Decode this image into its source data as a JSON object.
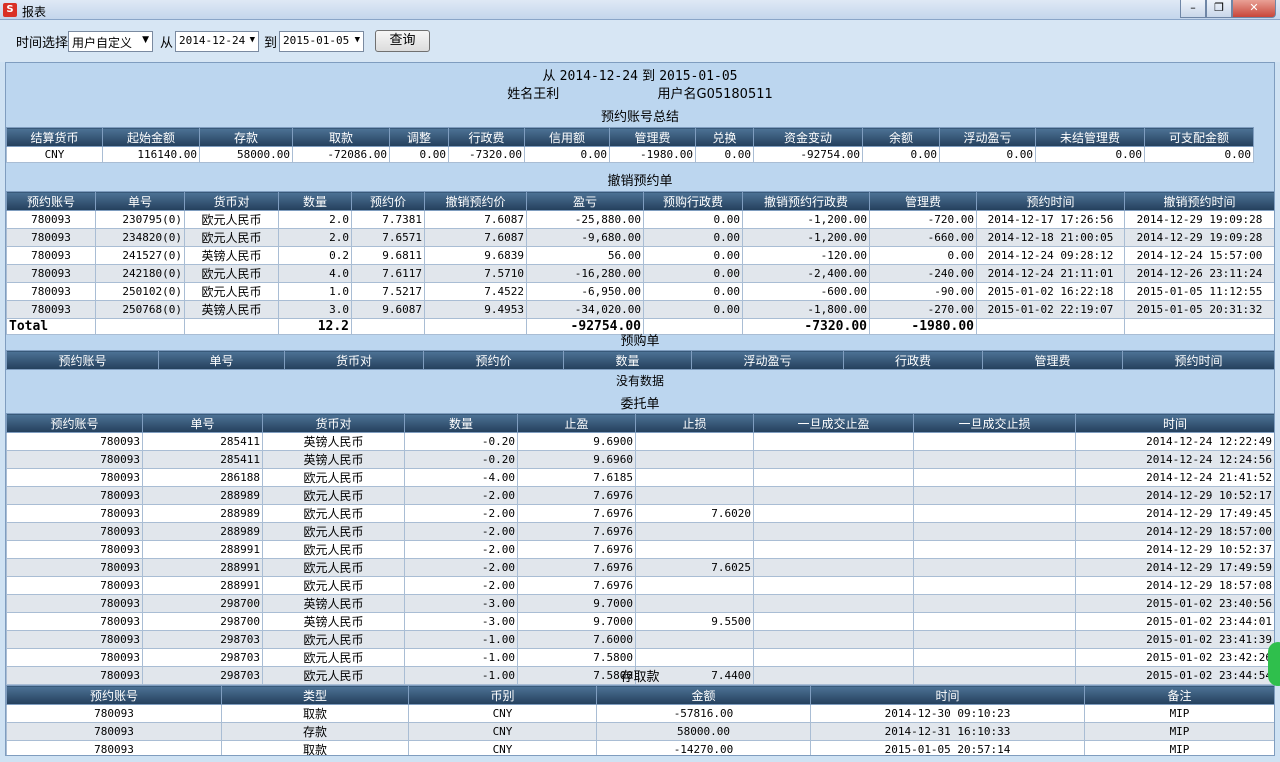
{
  "window": {
    "title": "报表",
    "icon": "S",
    "controls": [
      "minimize-icon",
      "restore-icon",
      "close-icon"
    ]
  },
  "toolbar": {
    "time_label": "时间选择",
    "time_option": "用户自定义",
    "from_label": "从",
    "from_date": "2014-12-24",
    "to_label": "到",
    "to_date": "2015-01-05",
    "query_label": "查询"
  },
  "report": {
    "range": {
      "from": "从",
      "from_date": "2014-12-24",
      "to": "到",
      "to_date": "2015-01-05"
    },
    "name": "姓名王利",
    "user": "用户名G05180511",
    "summary": {
      "title": "预约账号总结",
      "headers": [
        "结算货币",
        "起始金额",
        "存款",
        "取款",
        "调整",
        "行政费",
        "信用额",
        "管理费",
        "兑换",
        "资金变动",
        "余额",
        "浮动盈亏",
        "未结管理费",
        "可支配金额"
      ],
      "row": [
        "CNY",
        "116140.00",
        "58000.00",
        "-72086.00",
        "0.00",
        "-7320.00",
        "0.00",
        "-1980.00",
        "0.00",
        "-92754.00",
        "0.00",
        "0.00",
        "0.00",
        "0.00"
      ]
    },
    "cancel": {
      "title": "撤销预约单",
      "headers": [
        "预约账号",
        "单号",
        "货币对",
        "数量",
        "预约价",
        "撤销预约价",
        "盈亏",
        "预购行政费",
        "撤销预约行政费",
        "管理费",
        "预约时间",
        "撤销预约时间"
      ],
      "rows": [
        [
          "780093",
          "230795(0)",
          "欧元人民币",
          "2.0",
          "7.7381",
          "7.6087",
          "-25,880.00",
          "0.00",
          "-1,200.00",
          "-720.00",
          "2014-12-17 17:26:56",
          "2014-12-29 19:09:28"
        ],
        [
          "780093",
          "234820(0)",
          "欧元人民币",
          "2.0",
          "7.6571",
          "7.6087",
          "-9,680.00",
          "0.00",
          "-1,200.00",
          "-660.00",
          "2014-12-18 21:00:05",
          "2014-12-29 19:09:28"
        ],
        [
          "780093",
          "241527(0)",
          "英镑人民币",
          "0.2",
          "9.6811",
          "9.6839",
          "56.00",
          "0.00",
          "-120.00",
          "0.00",
          "2014-12-24 09:28:12",
          "2014-12-24 15:57:00"
        ],
        [
          "780093",
          "242180(0)",
          "欧元人民币",
          "4.0",
          "7.6117",
          "7.5710",
          "-16,280.00",
          "0.00",
          "-2,400.00",
          "-240.00",
          "2014-12-24 21:11:01",
          "2014-12-26 23:11:24"
        ],
        [
          "780093",
          "250102(0)",
          "欧元人民币",
          "1.0",
          "7.5217",
          "7.4522",
          "-6,950.00",
          "0.00",
          "-600.00",
          "-90.00",
          "2015-01-02 16:22:18",
          "2015-01-05 11:12:55"
        ],
        [
          "780093",
          "250768(0)",
          "英镑人民币",
          "3.0",
          "9.6087",
          "9.4953",
          "-34,020.00",
          "0.00",
          "-1,800.00",
          "-270.00",
          "2015-01-02 22:19:07",
          "2015-01-05 20:31:32"
        ]
      ],
      "total": [
        "Total",
        "",
        "",
        "12.2",
        "",
        "",
        "-92754.00",
        "",
        "-7320.00",
        "-1980.00",
        "",
        ""
      ]
    },
    "presale": {
      "title": "预购单",
      "headers": [
        "预约账号",
        "单号",
        "货币对",
        "预约价",
        "数量",
        "浮动盈亏",
        "行政费",
        "管理费",
        "预约时间"
      ],
      "empty": "没有数据"
    },
    "orders": {
      "title": "委托单",
      "headers": [
        "预约账号",
        "单号",
        "货币对",
        "数量",
        "止盈",
        "止损",
        "一旦成交止盈",
        "一旦成交止损",
        "时间"
      ],
      "rows": [
        [
          "780093",
          "285411",
          "英镑人民币",
          "-0.20",
          "9.6900",
          "",
          "",
          "",
          "2014-12-24 12:22:49"
        ],
        [
          "780093",
          "285411",
          "英镑人民币",
          "-0.20",
          "9.6960",
          "",
          "",
          "",
          "2014-12-24 12:24:56"
        ],
        [
          "780093",
          "286188",
          "欧元人民币",
          "-4.00",
          "7.6185",
          "",
          "",
          "",
          "2014-12-24 21:41:52"
        ],
        [
          "780093",
          "288989",
          "欧元人民币",
          "-2.00",
          "7.6976",
          "",
          "",
          "",
          "2014-12-29 10:52:17"
        ],
        [
          "780093",
          "288989",
          "欧元人民币",
          "-2.00",
          "7.6976",
          "7.6020",
          "",
          "",
          "2014-12-29 17:49:45"
        ],
        [
          "780093",
          "288989",
          "欧元人民币",
          "-2.00",
          "7.6976",
          "",
          "",
          "",
          "2014-12-29 18:57:00"
        ],
        [
          "780093",
          "288991",
          "欧元人民币",
          "-2.00",
          "7.6976",
          "",
          "",
          "",
          "2014-12-29 10:52:37"
        ],
        [
          "780093",
          "288991",
          "欧元人民币",
          "-2.00",
          "7.6976",
          "7.6025",
          "",
          "",
          "2014-12-29 17:49:59"
        ],
        [
          "780093",
          "288991",
          "欧元人民币",
          "-2.00",
          "7.6976",
          "",
          "",
          "",
          "2014-12-29 18:57:08"
        ],
        [
          "780093",
          "298700",
          "英镑人民币",
          "-3.00",
          "9.7000",
          "",
          "",
          "",
          "2015-01-02 23:40:56"
        ],
        [
          "780093",
          "298700",
          "英镑人民币",
          "-3.00",
          "9.7000",
          "9.5500",
          "",
          "",
          "2015-01-02 23:44:01"
        ],
        [
          "780093",
          "298703",
          "欧元人民币",
          "-1.00",
          "7.6000",
          "",
          "",
          "",
          "2015-01-02 23:41:39"
        ],
        [
          "780093",
          "298703",
          "欧元人民币",
          "-1.00",
          "7.5800",
          "",
          "",
          "",
          "2015-01-02 23:42:26"
        ],
        [
          "780093",
          "298703",
          "欧元人民币",
          "-1.00",
          "7.5800",
          "7.4400",
          "",
          "",
          "2015-01-02 23:44:54"
        ]
      ]
    },
    "deposits": {
      "title": "存取款",
      "headers": [
        "预约账号",
        "类型",
        "币别",
        "金额",
        "时间",
        "备注"
      ],
      "rows": [
        [
          "780093",
          "取款",
          "CNY",
          "-57816.00",
          "2014-12-30 09:10:23",
          "MIP"
        ],
        [
          "780093",
          "存款",
          "CNY",
          "58000.00",
          "2014-12-31 16:10:33",
          "MIP"
        ],
        [
          "780093",
          "取款",
          "CNY",
          "-14270.00",
          "2015-01-05 20:57:14",
          "MIP"
        ]
      ]
    }
  }
}
